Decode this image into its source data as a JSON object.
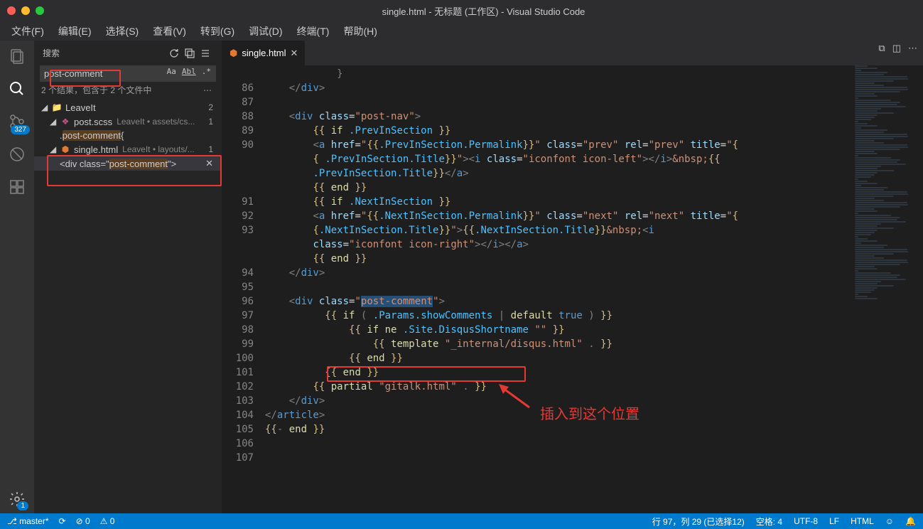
{
  "window": {
    "title": "single.html - 无标题 (工作区) - Visual Studio Code"
  },
  "menubar": [
    "文件(F)",
    "编辑(E)",
    "选择(S)",
    "查看(V)",
    "转到(G)",
    "调试(D)",
    "终端(T)",
    "帮助(H)"
  ],
  "activity": {
    "scm_badge": "327",
    "gear_badge": "1"
  },
  "sidebar": {
    "title": "搜索",
    "search_value": "post-comment",
    "results_meta": "2 个结果，包含于 2 个文件中",
    "groups": [
      {
        "folder": "LeaveIt",
        "count": "2",
        "files": [
          {
            "name": "post.scss",
            "path": "LeaveIt • assets/cs...",
            "count": "1",
            "matches": [
              {
                "pre": ".",
                "hl": "post-comment",
                "post": "{"
              }
            ]
          },
          {
            "name": "single.html",
            "path": "LeaveIt • layouts/...",
            "count": "1",
            "matches": [
              {
                "pre": "<div class=\"",
                "hl": "post-comment",
                "post": "\">"
              }
            ]
          }
        ]
      }
    ]
  },
  "tab": {
    "name": "single.html"
  },
  "gutter": [
    " ",
    "86",
    "87",
    "88",
    "89",
    "90",
    " ",
    " ",
    " ",
    "91",
    "92",
    "93",
    " ",
    " ",
    "94",
    "95",
    "96",
    "97",
    "98",
    "99",
    "100",
    "101",
    "102",
    "103",
    "104",
    "105",
    "106",
    "107"
  ],
  "statusbar": {
    "branch": "master*",
    "sync": "",
    "errors": "0",
    "warnings": "0",
    "pos": "行 97，列 29 (已选择12)",
    "spaces": "空格: 4",
    "encoding": "UTF-8",
    "eol": "LF",
    "lang": "HTML"
  },
  "annotation": "插入到这个位置"
}
